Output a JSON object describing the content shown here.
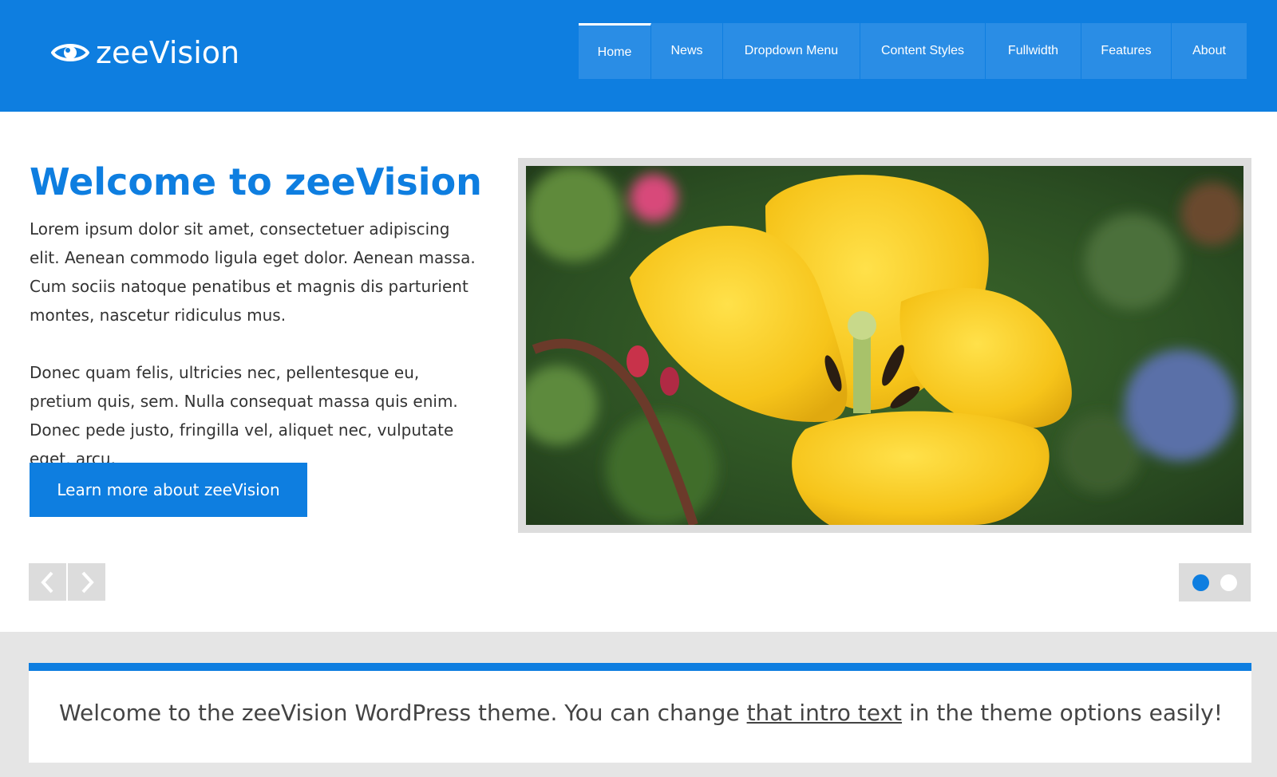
{
  "brand": {
    "name": "zeeVision",
    "logo_icon": "eye-icon"
  },
  "nav": {
    "items": [
      {
        "label": "Home",
        "active": true
      },
      {
        "label": "News"
      },
      {
        "label": "Dropdown Menu"
      },
      {
        "label": "Content Styles"
      },
      {
        "label": "Fullwidth"
      },
      {
        "label": "Features"
      },
      {
        "label": "About"
      }
    ]
  },
  "slide": {
    "title": "Welcome to zeeVision",
    "paragraph1": "Lorem ipsum dolor sit amet, consectetuer adipiscing elit. Aenean commodo ligula eget dolor. Aenean massa. Cum sociis natoque penatibus et magnis dis parturient montes, nascetur ridiculus mus.",
    "paragraph2": "Donec quam felis, ultricies nec, pellentesque eu, pretium quis, sem. Nulla consequat massa quis enim. Donec pede justo, fringilla vel, aliquet nec, vulputate eget, arcu.",
    "button_label": "Learn more about zeeVision",
    "image_icon": "yellow-tulip-photo",
    "pager": {
      "count": 2,
      "active": 1
    }
  },
  "intro": {
    "before": "Welcome to the zeeVision WordPress theme. You can change ",
    "link": "that intro text",
    "after": " in the theme options easily!"
  },
  "colors": {
    "accent": "#0e7ee0",
    "nav_item": "#2a8de5",
    "background": "#e5e5e5",
    "control_gray": "#dcdcdc"
  }
}
